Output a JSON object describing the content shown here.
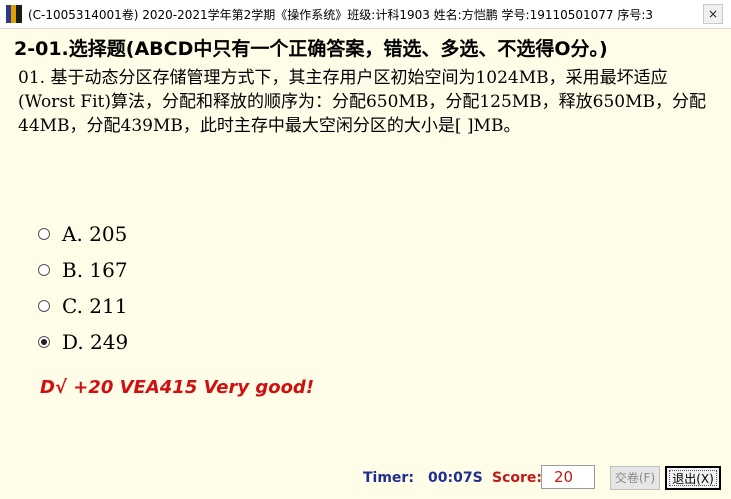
{
  "window": {
    "title": "(C-1005314001卷) 2020-2021学年第2学期《操作系统》班级:计科1903 姓名:方恺鹏 学号:19110501077 序号:3",
    "close_label": "×"
  },
  "heading": "2-01.选择题(ABCD中只有一个正确答案，错选、多选、不选得O分。)",
  "question": {
    "text": "01. 基于动态分区存储管理方式下，其主存用户区初始空间为1024MB，采用最坏适应(Worst Fit)算法，分配和释放的顺序为：分配650MB，分配125MB，释放650MB，分配44MB，分配439MB，此时主存中最大空闲分区的大小是[      ]MB。"
  },
  "options": [
    {
      "label": "A. 205",
      "selected": false
    },
    {
      "label": "B. 167",
      "selected": false
    },
    {
      "label": "C. 211",
      "selected": false
    },
    {
      "label": "D. 249",
      "selected": true
    }
  ],
  "feedback": "D√ +20  VEA415 Very good!",
  "footer": {
    "timer_label": "Timer:",
    "timer_value": "00:07S",
    "score_label": "Score:",
    "score_value": "20",
    "submit_label": "交卷(F)",
    "exit_label": "退出(X)"
  },
  "colors": {
    "background": "#fffde7",
    "feedback": "#d01010",
    "timer": "#1f2f8f",
    "score": "#c01818"
  }
}
